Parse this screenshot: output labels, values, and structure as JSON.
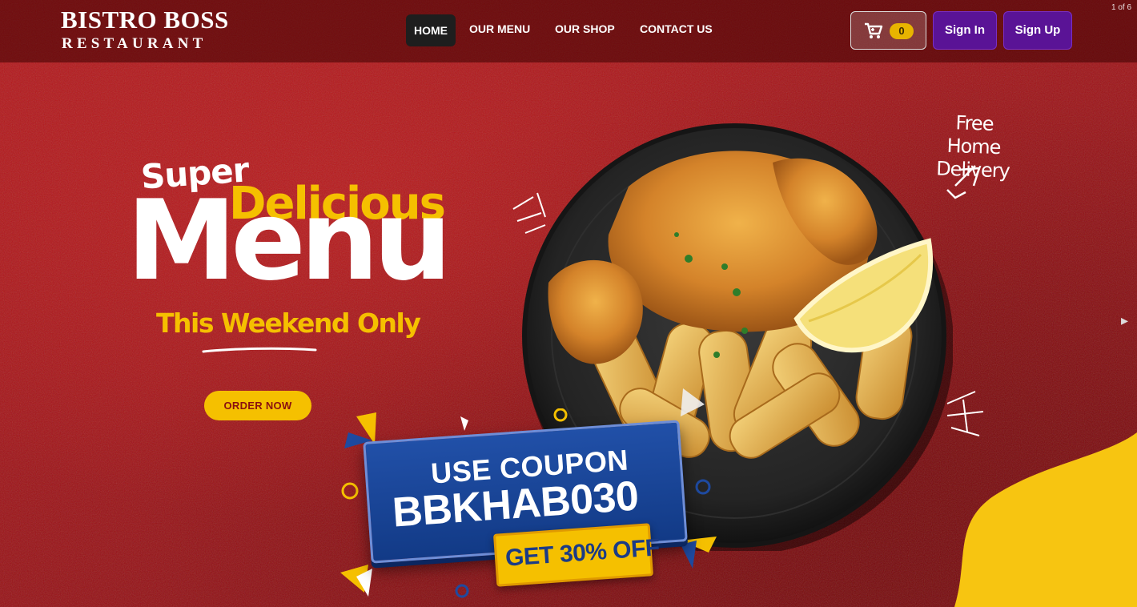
{
  "brand": {
    "title": "BISTRO BOSS",
    "subtitle": "RESTAURANT"
  },
  "nav": {
    "links": [
      {
        "label": "HOME",
        "active": true
      },
      {
        "label": "OUR MENU",
        "active": false
      },
      {
        "label": "OUR SHOP",
        "active": false
      },
      {
        "label": "CONTACT US",
        "active": false
      }
    ],
    "cart_icon": "cart-icon",
    "cart_count": "0",
    "sign_in": "Sign In",
    "sign_up": "Sign Up"
  },
  "slider": {
    "counter": "1 of 6",
    "next_icon": "chevron-right-icon"
  },
  "hero": {
    "super": "Super",
    "delicious": "Delicious",
    "menu": "Menu",
    "weekend": "This Weekend Only",
    "order_button": "ORDER NOW",
    "free_delivery_line1": "Free Home",
    "free_delivery_line2": "Delivery",
    "coupon_line1": "USE COUPON",
    "coupon_code": "BBKHAB030",
    "discount": "GET 30% OFF"
  },
  "colors": {
    "accent_yellow": "#f5c000",
    "brand_red": "#9e1216",
    "button_purple": "#5a1396",
    "coupon_blue": "#1b3b86"
  }
}
